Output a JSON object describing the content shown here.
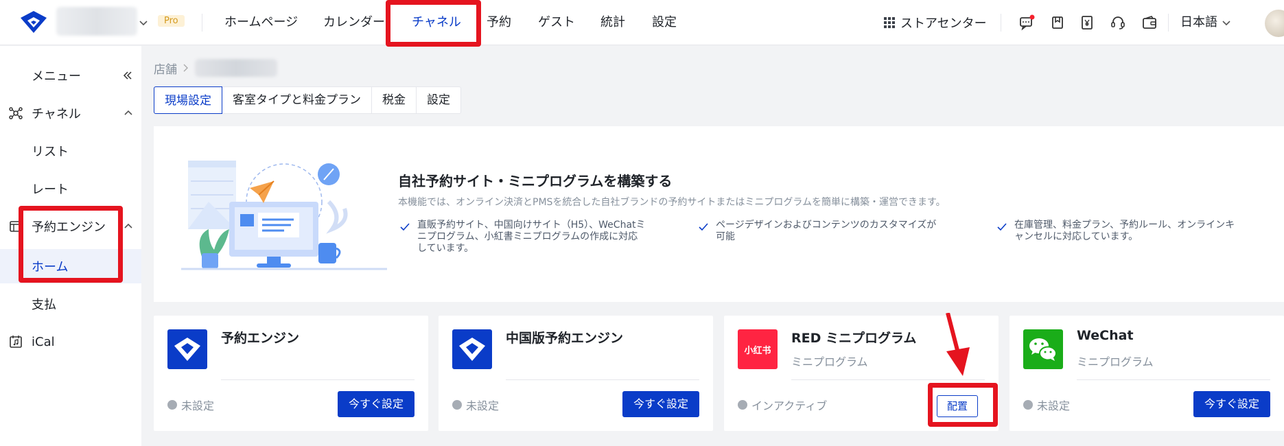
{
  "header": {
    "pro_badge": "Pro",
    "nav": [
      "ホームページ",
      "カレンダー",
      "チャネル",
      "予約",
      "ゲスト",
      "統計",
      "設定"
    ],
    "active_nav": "チャネル",
    "store_center": "ストアセンター",
    "language": "日本語"
  },
  "sidebar": {
    "menu_label": "メニュー",
    "channel_group": "チャネル",
    "list": "リスト",
    "rate": "レート",
    "booking_engine": "予約エンジン",
    "home": "ホーム",
    "payment": "支払",
    "ical": "iCal"
  },
  "breadcrumb": {
    "root": "店舗"
  },
  "tabs": [
    "現場設定",
    "客室タイプと料金プラン",
    "税金",
    "設定"
  ],
  "banner": {
    "title": "自社予約サイト・ミニプログラムを構築する",
    "description": "本機能では、オンライン決済とPMSを統合した自社ブランドの予約サイトまたはミニプログラムを簡単に構築・運営できます。",
    "features": [
      [
        "直販予約サイト、中国向けサイト（H5）、WeChatミ",
        "ニプログラム、小紅書ミニプログラムの作成に対応",
        "しています。"
      ],
      [
        "ページデザインおよびコンテンツのカスタマイズが",
        "可能"
      ],
      [
        "在庫管理、料金プラン、予約ルール、オンラインキ",
        "ャンセルに対応しています。"
      ]
    ]
  },
  "cards": [
    {
      "title": "予約エンジン",
      "subtitle": "",
      "status": "未設定",
      "action": "今すぐ設定"
    },
    {
      "title": "中国版予約エンジン",
      "subtitle": "",
      "status": "未設定",
      "action": "今すぐ設定"
    },
    {
      "title": "RED ミニプログラム",
      "subtitle": "ミニプログラム",
      "status": "インアクティブ",
      "action": "配置",
      "logo_text": "小红书"
    },
    {
      "title": "WeChat",
      "subtitle": "ミニプログラム",
      "status": "未設定",
      "action": "今すぐ設定"
    }
  ],
  "colors": {
    "primary": "#0a3cc8",
    "highlight": "#e5141f",
    "red_brand": "#ff2442",
    "wechat_green": "#1aad19"
  }
}
